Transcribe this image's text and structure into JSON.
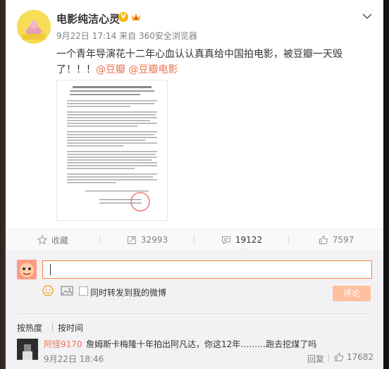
{
  "post": {
    "username": "电影纯洁心灵",
    "verified_mark": "V",
    "meta": {
      "time": "9月22日 17:14",
      "source": "来自 360安全浏览器"
    },
    "text_line1": "一个青年导演花十二年心血认认真真给中国拍电影，被豆瓣一天毁了！！！",
    "mention1": "@豆瓣",
    "mention2": "@豆瓣电影"
  },
  "actions": {
    "favorite": "收藏",
    "repost": "32993",
    "comment": "19122",
    "like": "7597"
  },
  "composer": {
    "input_value": "",
    "repost_label": "同时转发到我的微博",
    "submit_label": "评论"
  },
  "sort": {
    "hot": "按热度",
    "time": "按时间"
  },
  "comment": {
    "user": "阿怪9170",
    "text": "詹姆斯卡梅隆十年拍出阿凡达，你这12年………跑去挖煤了吗",
    "time": "9月22日 18:46",
    "reply": "回复",
    "likes": "17682"
  },
  "colors": {
    "accent": "#eb7350",
    "input_border": "#fa7d3c",
    "submit_disabled": "#ffc09f",
    "comment_bg": "#f2f2f5"
  },
  "icons": {
    "verified": "verified-icon",
    "member": "member-icon",
    "chevron": "chevron-down-icon",
    "favorite": "star-icon",
    "repost": "repost-icon",
    "comment": "comment-icon",
    "like": "thumb-up-icon",
    "emoji": "emoji-icon",
    "image": "image-icon"
  }
}
